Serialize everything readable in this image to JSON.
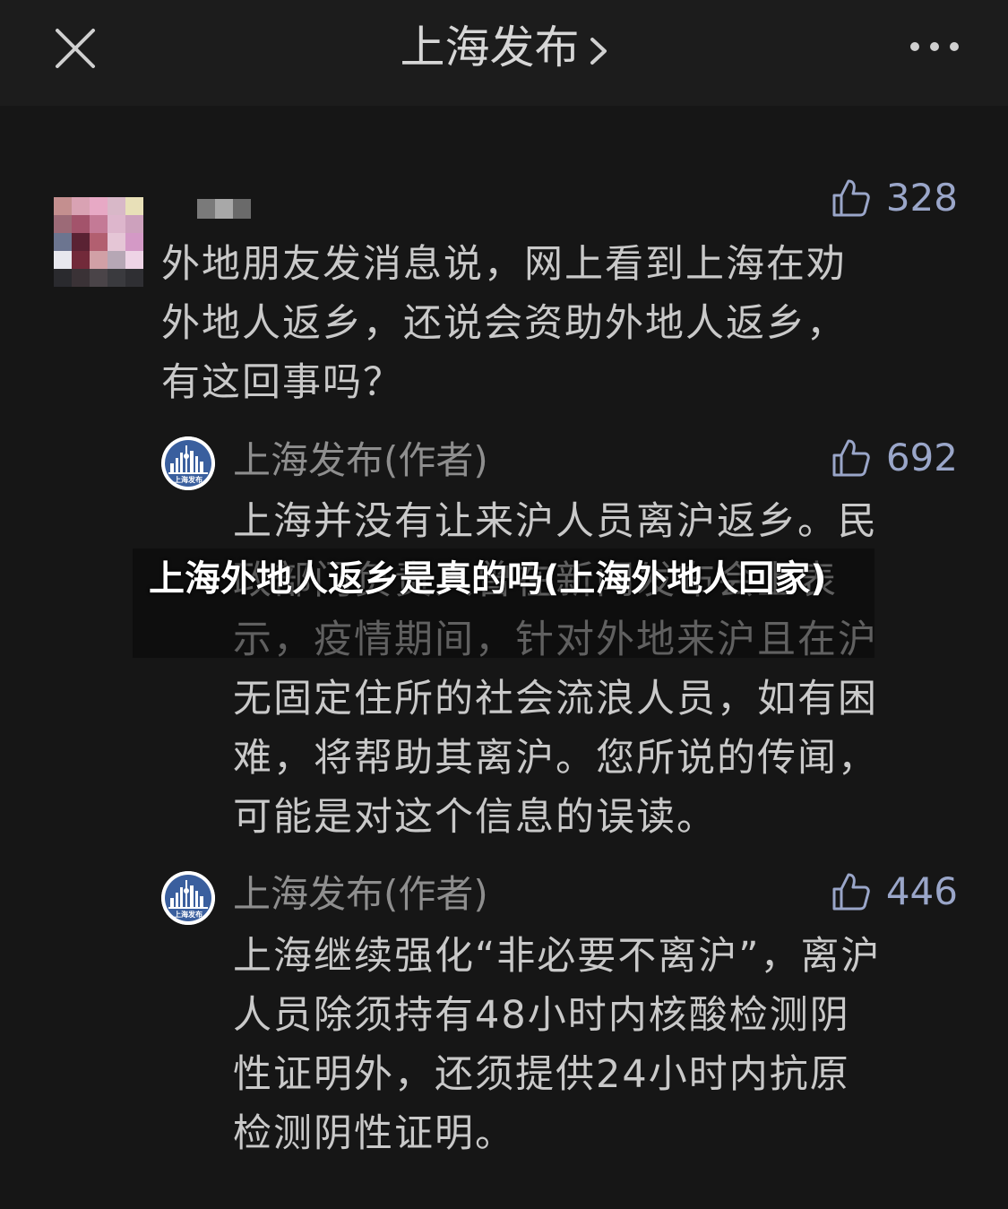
{
  "header": {
    "title": "上海发布"
  },
  "comments": [
    {
      "likes": "328",
      "text": "外地朋友发消息说，网上看到上海在劝\n外地人返乡，还说会资助外地人返乡，\n有这回事吗？"
    },
    {
      "author": "上海发布(作者)",
      "likes": "692",
      "text": "上海并没有让来沪人员离沪返乡。民\n政部门负责人曾在新闻发布会上表\n示，疫情期间，针对外地来沪且在沪\n无固定住所的社会流浪人员，如有困\n难，将帮助其离沪。您所说的传闻，\n可能是对这个信息的误读。"
    },
    {
      "author": "上海发布(作者)",
      "likes": "446",
      "text": "上海继续强化“非必要不离沪”，离沪\n人员除须持有48小时内核酸检测阴\n性证明外，还须提供24小时内抗原\n检测阴性证明。"
    }
  ],
  "org_avatar_label": "上海发布",
  "overlay_caption": "上海外地人返乡是真的吗(上海外地人回家)",
  "colors": {
    "background": "#161616",
    "topbar": "#1c1c1c",
    "text": "#c9c9c9",
    "like": "#9aa6c9",
    "avatar_blue": "#3a5f9e"
  },
  "icons": {
    "close": "close-icon",
    "chevron": "chevron-right-icon",
    "more": "more-icon",
    "like": "thumbs-up-icon"
  }
}
